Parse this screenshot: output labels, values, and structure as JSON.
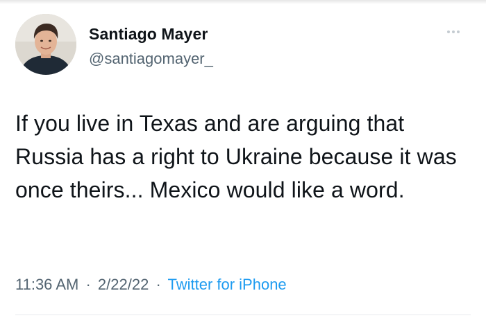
{
  "author": {
    "display_name": "Santiago Mayer",
    "handle": "@santiagomayer_"
  },
  "tweet": {
    "text": "If you live in Texas and are arguing that Russia has a right to Ukraine because it was once theirs... Mexico would like a word."
  },
  "meta": {
    "time": "11:36 AM",
    "date": "2/22/22",
    "source": "Twitter for iPhone",
    "separator": "·"
  },
  "icons": {
    "more": "more-options-icon"
  },
  "colors": {
    "name": "#0f1419",
    "secondary": "#536471",
    "link": "#1d9bf0"
  }
}
